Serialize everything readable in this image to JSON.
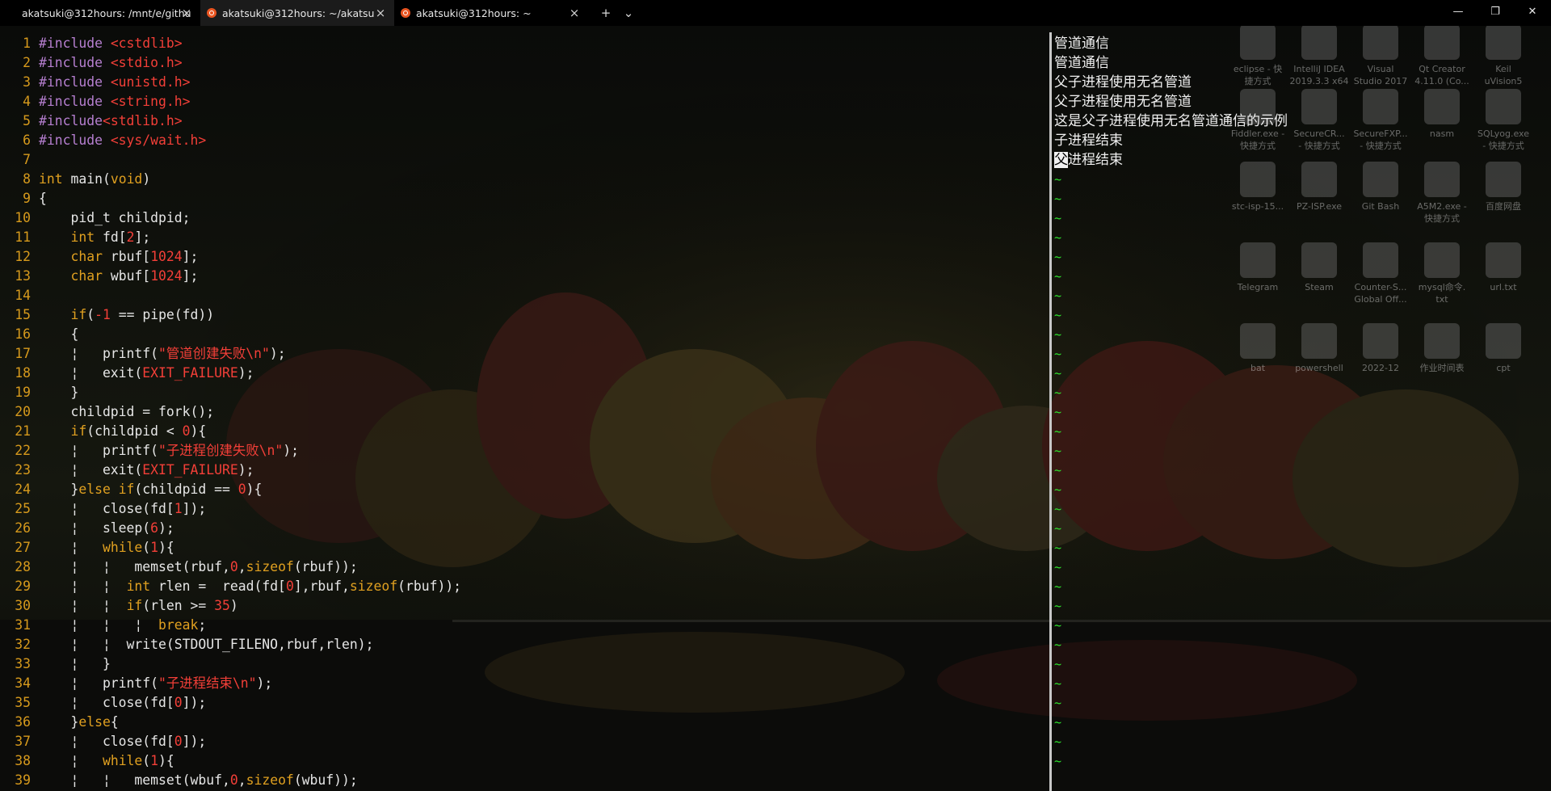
{
  "tabs": [
    {
      "title": "akatsuki@312hours: /mnt/e/githu",
      "active": false
    },
    {
      "title": "akatsuki@312hours: ~/akatsu",
      "active": true
    },
    {
      "title": "akatsuki@312hours: ~",
      "active": false
    }
  ],
  "tabbar": {
    "new_tab": "+",
    "dropdown": "⌄",
    "close": "×"
  },
  "window_controls": {
    "minimize": "—",
    "maximize": "❐",
    "close": "✕"
  },
  "desktop_icons": [
    {
      "label": "eclipse - 快\n捷方式"
    },
    {
      "label": "IntelliJ IDEA\n2019.3.3 x64"
    },
    {
      "label": "Visual\nStudio 2017"
    },
    {
      "label": "Qt Creator\n4.11.0 (Co..."
    },
    {
      "label": "Keil\nuVision5"
    },
    {
      "label": "Fiddler.exe -\n快捷方式"
    },
    {
      "label": "SecureCR...\n- 快捷方式"
    },
    {
      "label": "SecureFXP...\n- 快捷方式"
    },
    {
      "label": "nasm"
    },
    {
      "label": "SQLyog.exe\n- 快捷方式"
    },
    {
      "label": "stc-isp-15..."
    },
    {
      "label": "PZ-ISP.exe"
    },
    {
      "label": "Git Bash"
    },
    {
      "label": "A5M2.exe -\n快捷方式"
    },
    {
      "label": "百度网盘"
    },
    {
      "label": "Telegram"
    },
    {
      "label": "Steam"
    },
    {
      "label": "Counter-S...\nGlobal Off..."
    },
    {
      "label": "mysql命令.\ntxt"
    },
    {
      "label": "url.txt"
    },
    {
      "label": "bat"
    },
    {
      "label": "powershell"
    },
    {
      "label": "2022-12"
    },
    {
      "label": "作业时间表"
    },
    {
      "label": "cpt"
    }
  ],
  "code_lines": [
    {
      "n": "1",
      "tokens": [
        [
          "pre",
          "#include "
        ],
        [
          "inc",
          "<cstdlib>"
        ]
      ]
    },
    {
      "n": "2",
      "tokens": [
        [
          "pre",
          "#include "
        ],
        [
          "inc",
          "<stdio.h>"
        ]
      ]
    },
    {
      "n": "3",
      "tokens": [
        [
          "pre",
          "#include "
        ],
        [
          "inc",
          "<unistd.h>"
        ]
      ]
    },
    {
      "n": "4",
      "tokens": [
        [
          "pre",
          "#include "
        ],
        [
          "inc",
          "<string.h>"
        ]
      ]
    },
    {
      "n": "5",
      "tokens": [
        [
          "pre",
          "#include"
        ],
        [
          "inc",
          "<stdlib.h>"
        ]
      ]
    },
    {
      "n": "6",
      "tokens": [
        [
          "pre",
          "#include "
        ],
        [
          "inc",
          "<sys/wait.h>"
        ]
      ]
    },
    {
      "n": "7",
      "tokens": []
    },
    {
      "n": "8",
      "tokens": [
        [
          "type",
          "int"
        ],
        [
          "plain",
          " main("
        ],
        [
          "type",
          "void"
        ],
        [
          "plain",
          ")"
        ]
      ]
    },
    {
      "n": "9",
      "tokens": [
        [
          "plain",
          "{"
        ]
      ]
    },
    {
      "n": "10",
      "tokens": [
        [
          "plain",
          "    pid_t childpid;"
        ]
      ]
    },
    {
      "n": "11",
      "tokens": [
        [
          "plain",
          "    "
        ],
        [
          "type",
          "int"
        ],
        [
          "plain",
          " fd["
        ],
        [
          "num",
          "2"
        ],
        [
          "plain",
          "];"
        ]
      ]
    },
    {
      "n": "12",
      "tokens": [
        [
          "plain",
          "    "
        ],
        [
          "type",
          "char"
        ],
        [
          "plain",
          " rbuf["
        ],
        [
          "num",
          "1024"
        ],
        [
          "plain",
          "];"
        ]
      ]
    },
    {
      "n": "13",
      "tokens": [
        [
          "plain",
          "    "
        ],
        [
          "type",
          "char"
        ],
        [
          "plain",
          " wbuf["
        ],
        [
          "num",
          "1024"
        ],
        [
          "plain",
          "];"
        ]
      ]
    },
    {
      "n": "14",
      "tokens": []
    },
    {
      "n": "15",
      "tokens": [
        [
          "plain",
          "    "
        ],
        [
          "kw",
          "if"
        ],
        [
          "plain",
          "("
        ],
        [
          "num",
          "-1"
        ],
        [
          "plain",
          " == pipe(fd))"
        ]
      ]
    },
    {
      "n": "16",
      "tokens": [
        [
          "plain",
          "    {"
        ]
      ]
    },
    {
      "n": "17",
      "tokens": [
        [
          "plain",
          "    ¦   printf("
        ],
        [
          "str",
          "\"管道创建失败\\n\""
        ],
        [
          "plain",
          ");"
        ]
      ]
    },
    {
      "n": "18",
      "tokens": [
        [
          "plain",
          "    ¦   exit("
        ],
        [
          "mac",
          "EXIT_FAILURE"
        ],
        [
          "plain",
          ");"
        ]
      ]
    },
    {
      "n": "19",
      "tokens": [
        [
          "plain",
          "    }"
        ]
      ]
    },
    {
      "n": "20",
      "tokens": [
        [
          "plain",
          "    childpid = fork();"
        ]
      ]
    },
    {
      "n": "21",
      "tokens": [
        [
          "plain",
          "    "
        ],
        [
          "kw",
          "if"
        ],
        [
          "plain",
          "(childpid < "
        ],
        [
          "num",
          "0"
        ],
        [
          "plain",
          "){"
        ]
      ]
    },
    {
      "n": "22",
      "tokens": [
        [
          "plain",
          "    ¦   printf("
        ],
        [
          "str",
          "\"子进程创建失败\\n\""
        ],
        [
          "plain",
          ");"
        ]
      ]
    },
    {
      "n": "23",
      "tokens": [
        [
          "plain",
          "    ¦   exit("
        ],
        [
          "mac",
          "EXIT_FAILURE"
        ],
        [
          "plain",
          ");"
        ]
      ]
    },
    {
      "n": "24",
      "tokens": [
        [
          "plain",
          "    }"
        ],
        [
          "kw",
          "else if"
        ],
        [
          "plain",
          "(childpid == "
        ],
        [
          "num",
          "0"
        ],
        [
          "plain",
          "){"
        ]
      ]
    },
    {
      "n": "25",
      "tokens": [
        [
          "plain",
          "    ¦   close(fd["
        ],
        [
          "num",
          "1"
        ],
        [
          "plain",
          "]);"
        ]
      ]
    },
    {
      "n": "26",
      "tokens": [
        [
          "plain",
          "    ¦   sleep("
        ],
        [
          "num",
          "6"
        ],
        [
          "plain",
          ");"
        ]
      ]
    },
    {
      "n": "27",
      "tokens": [
        [
          "plain",
          "    ¦   "
        ],
        [
          "kw",
          "while"
        ],
        [
          "plain",
          "("
        ],
        [
          "num",
          "1"
        ],
        [
          "plain",
          "){"
        ]
      ]
    },
    {
      "n": "28",
      "tokens": [
        [
          "plain",
          "    ¦   ¦   memset(rbuf,"
        ],
        [
          "num",
          "0"
        ],
        [
          "plain",
          ","
        ],
        [
          "kw",
          "sizeof"
        ],
        [
          "plain",
          "(rbuf));"
        ]
      ]
    },
    {
      "n": "29",
      "tokens": [
        [
          "plain",
          "    ¦   ¦  "
        ],
        [
          "type",
          "int"
        ],
        [
          "plain",
          " rlen =  read(fd["
        ],
        [
          "num",
          "0"
        ],
        [
          "plain",
          "],rbuf,"
        ],
        [
          "kw",
          "sizeof"
        ],
        [
          "plain",
          "(rbuf));"
        ]
      ]
    },
    {
      "n": "30",
      "tokens": [
        [
          "plain",
          "    ¦   ¦  "
        ],
        [
          "kw",
          "if"
        ],
        [
          "plain",
          "(rlen >= "
        ],
        [
          "num",
          "35"
        ],
        [
          "plain",
          ")"
        ]
      ]
    },
    {
      "n": "31",
      "tokens": [
        [
          "plain",
          "    ¦   ¦   ¦  "
        ],
        [
          "kw",
          "break"
        ],
        [
          "plain",
          ";"
        ]
      ]
    },
    {
      "n": "32",
      "tokens": [
        [
          "plain",
          "    ¦   ¦  write(STDOUT_FILENO,rbuf,rlen);"
        ]
      ]
    },
    {
      "n": "33",
      "tokens": [
        [
          "plain",
          "    ¦   }"
        ]
      ]
    },
    {
      "n": "34",
      "tokens": [
        [
          "plain",
          "    ¦   printf("
        ],
        [
          "str",
          "\"子进程结束\\n\""
        ],
        [
          "plain",
          ");"
        ]
      ]
    },
    {
      "n": "35",
      "tokens": [
        [
          "plain",
          "    ¦   close(fd["
        ],
        [
          "num",
          "0"
        ],
        [
          "plain",
          "]);"
        ]
      ]
    },
    {
      "n": "36",
      "tokens": [
        [
          "plain",
          "    }"
        ],
        [
          "kw",
          "else"
        ],
        [
          "plain",
          "{"
        ]
      ]
    },
    {
      "n": "37",
      "tokens": [
        [
          "plain",
          "    ¦   close(fd["
        ],
        [
          "num",
          "0"
        ],
        [
          "plain",
          "]);"
        ]
      ]
    },
    {
      "n": "38",
      "tokens": [
        [
          "plain",
          "    ¦   "
        ],
        [
          "kw",
          "while"
        ],
        [
          "plain",
          "("
        ],
        [
          "num",
          "1"
        ],
        [
          "plain",
          "){"
        ]
      ]
    },
    {
      "n": "39",
      "tokens": [
        [
          "plain",
          "    ¦   ¦   memset(wbuf,"
        ],
        [
          "num",
          "0"
        ],
        [
          "plain",
          ","
        ],
        [
          "kw",
          "sizeof"
        ],
        [
          "plain",
          "(wbuf));"
        ]
      ]
    }
  ],
  "output_lines": [
    "管道通信",
    "管道通信",
    "父子进程使用无名管道",
    "父子进程使用无名管道",
    "这是父子进程使用无名管道通信的示例",
    "子进程结束"
  ],
  "output_cursor_line": {
    "cursor_char": "父",
    "rest": "进程结束"
  },
  "tilde_char": "~",
  "tilde_count": 31
}
